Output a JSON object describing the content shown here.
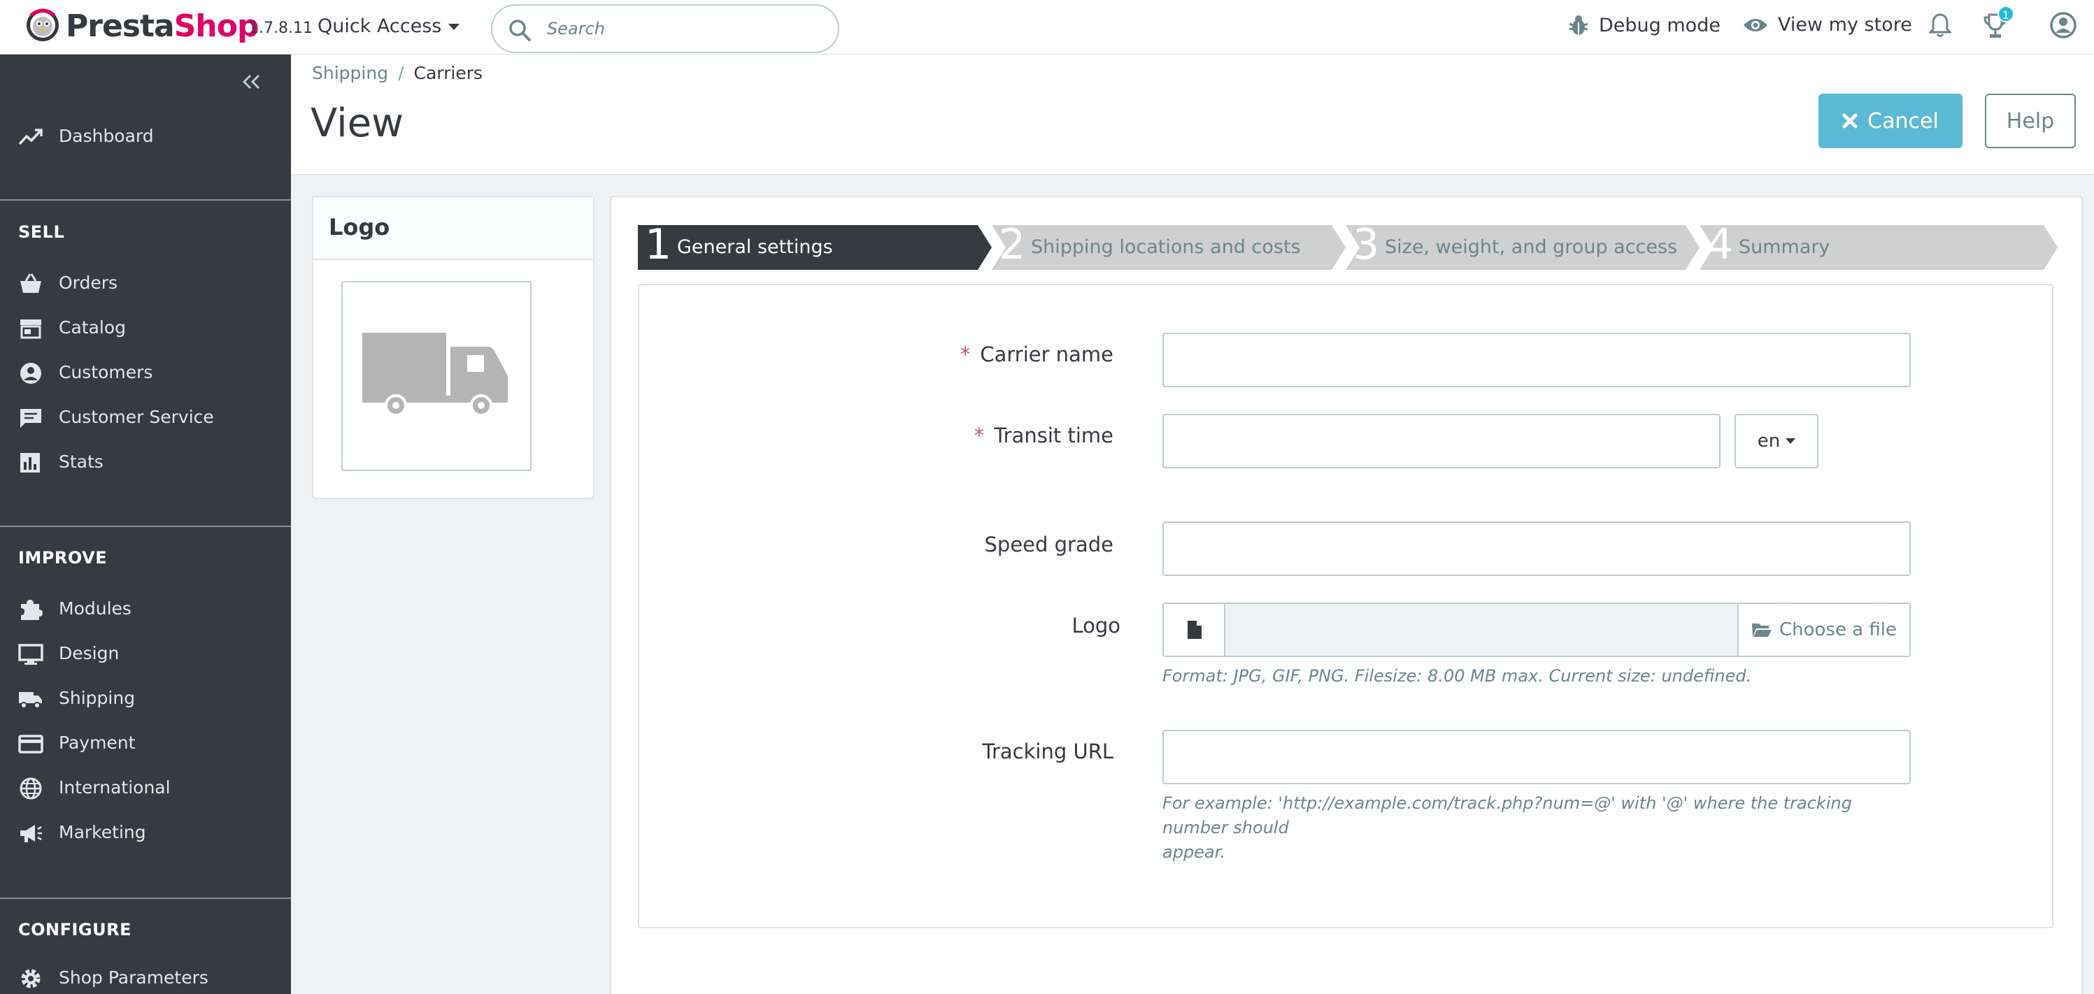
{
  "header": {
    "brand_presta": "Presta",
    "brand_shop": "Shop",
    "version": "1.7.8.11",
    "quick_access": "Quick Access",
    "search_placeholder": "Search",
    "debug_mode": "Debug mode",
    "view_store": "View my store",
    "notification_count": "1"
  },
  "sidebar": {
    "dashboard": "Dashboard",
    "sections": {
      "sell": "SELL",
      "improve": "IMPROVE",
      "configure": "CONFIGURE"
    },
    "items": {
      "orders": "Orders",
      "catalog": "Catalog",
      "customers": "Customers",
      "customer_service": "Customer Service",
      "stats": "Stats",
      "modules": "Modules",
      "design": "Design",
      "shipping": "Shipping",
      "payment": "Payment",
      "international": "International",
      "marketing": "Marketing",
      "shop_parameters": "Shop Parameters"
    }
  },
  "page": {
    "breadcrumb_parent": "Shipping",
    "breadcrumb_separator": "/",
    "breadcrumb_current": "Carriers",
    "title": "View",
    "cancel_label": "Cancel",
    "help_label": "Help"
  },
  "logo_panel": {
    "title": "Logo"
  },
  "wizard": {
    "steps": [
      {
        "number": "1",
        "label": "General settings",
        "active": true
      },
      {
        "number": "2",
        "label": "Shipping locations and costs",
        "active": false
      },
      {
        "number": "3",
        "label": "Size, weight, and group access",
        "active": false
      },
      {
        "number": "4",
        "label": "Summary",
        "active": false
      }
    ]
  },
  "form": {
    "required_marker": "*",
    "carrier_name_label": "Carrier name",
    "carrier_name_value": "",
    "transit_time_label": "Transit time",
    "transit_time_value": "",
    "language": "en",
    "speed_grade_label": "Speed grade",
    "speed_grade_value": "",
    "logo_label": "Logo",
    "choose_file_label": "Choose a file",
    "logo_help": "Format: JPG, GIF, PNG. Filesize: 8.00 MB max. Current size: undefined.",
    "tracking_url_label": "Tracking URL",
    "tracking_url_value": "",
    "tracking_help_line1": "For example: 'http://example.com/track.php?num=@' with '@' where the tracking number should",
    "tracking_help_line2": "appear."
  },
  "colors": {
    "sidebar_bg": "#363a41",
    "brand_pink": "#df0067",
    "accent_blue": "#25b9d7",
    "cancel_bg": "#5bb9d6",
    "wizard_active": "#363a41",
    "wizard_inactive": "#d0d0d0",
    "required_red": "#c05c67"
  }
}
